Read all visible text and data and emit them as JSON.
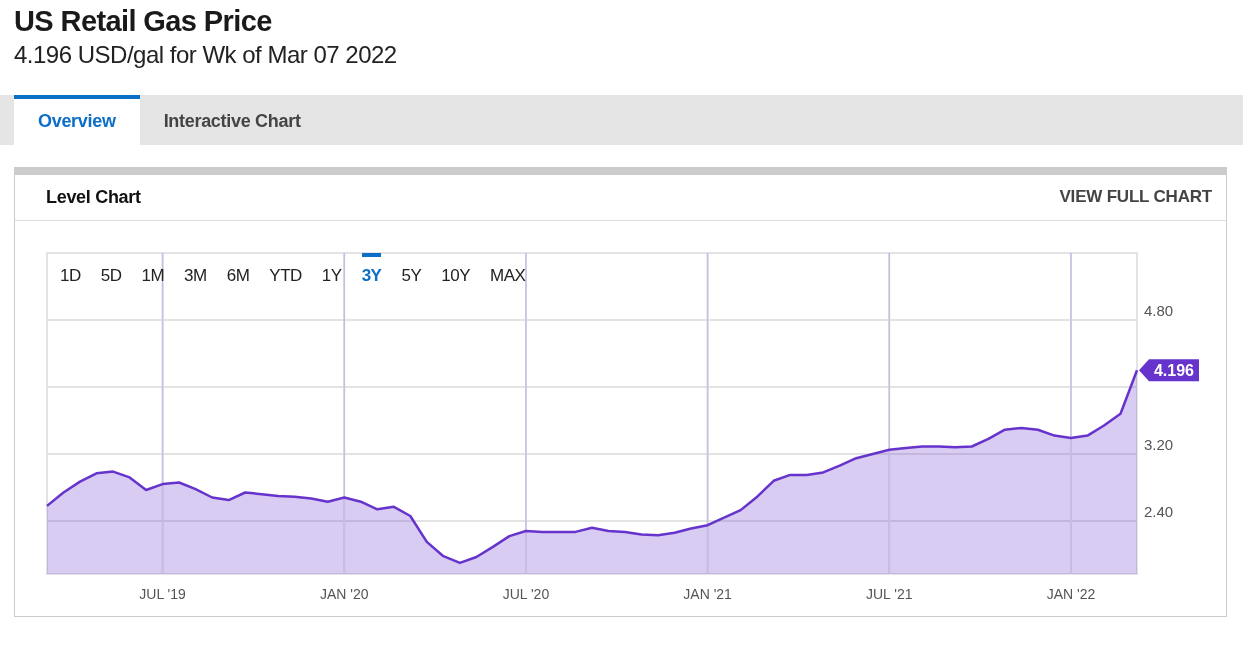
{
  "header": {
    "title": "US Retail Gas Price",
    "subtitle": "4.196 USD/gal for Wk of Mar 07 2022"
  },
  "tabs": [
    {
      "label": "Overview",
      "selected": true
    },
    {
      "label": "Interactive Chart",
      "selected": false
    }
  ],
  "card": {
    "title": "Level Chart",
    "link": "VIEW FULL CHART",
    "ranges": [
      {
        "label": "1D",
        "selected": false
      },
      {
        "label": "5D",
        "selected": false
      },
      {
        "label": "1M",
        "selected": false
      },
      {
        "label": "3M",
        "selected": false
      },
      {
        "label": "6M",
        "selected": false
      },
      {
        "label": "YTD",
        "selected": false
      },
      {
        "label": "1Y",
        "selected": false
      },
      {
        "label": "3Y",
        "selected": true
      },
      {
        "label": "5Y",
        "selected": false
      },
      {
        "label": "10Y",
        "selected": false
      },
      {
        "label": "MAX",
        "selected": false
      }
    ],
    "chart_data": {
      "type": "area",
      "grid": true,
      "ylim": [
        1.767,
        5.6
      ],
      "yticks": [
        {
          "value": 2.4,
          "label": "2.40"
        },
        {
          "value": 3.2,
          "label": "3.20"
        },
        {
          "value": 4.8,
          "label": "4.80"
        }
      ],
      "categories": [
        null,
        null,
        null,
        null,
        null,
        null,
        null,
        "JUL '19",
        null,
        null,
        null,
        null,
        null,
        null,
        null,
        null,
        null,
        null,
        "JAN '20",
        null,
        null,
        null,
        null,
        null,
        null,
        null,
        null,
        null,
        null,
        "JUL '20",
        null,
        null,
        null,
        null,
        null,
        null,
        null,
        null,
        null,
        null,
        "JAN '21",
        null,
        null,
        null,
        null,
        null,
        null,
        null,
        null,
        null,
        null,
        "JUL '21",
        null,
        null,
        null,
        null,
        null,
        null,
        null,
        null,
        null,
        null,
        "JAN '22",
        null,
        null,
        null,
        null
      ],
      "series": [
        {
          "color": "#6633cc",
          "values": [
            2.58,
            2.74,
            2.87,
            2.97,
            2.99,
            2.92,
            2.77,
            2.84,
            2.86,
            2.78,
            2.68,
            2.65,
            2.74,
            2.72,
            2.7,
            2.69,
            2.67,
            2.63,
            2.68,
            2.63,
            2.54,
            2.57,
            2.46,
            2.15,
            1.98,
            1.9,
            1.97,
            2.09,
            2.22,
            2.28,
            2.27,
            2.27,
            2.27,
            2.32,
            2.28,
            2.27,
            2.24,
            2.23,
            2.26,
            2.31,
            2.35,
            2.44,
            2.53,
            2.69,
            2.88,
            2.95,
            2.95,
            2.98,
            3.06,
            3.15,
            3.2,
            3.25,
            3.27,
            3.29,
            3.29,
            3.28,
            3.29,
            3.38,
            3.49,
            3.51,
            3.49,
            3.42,
            3.39,
            3.42,
            3.54,
            3.68,
            4.2
          ]
        }
      ],
      "annotations": [
        "4.196"
      ]
    }
  }
}
